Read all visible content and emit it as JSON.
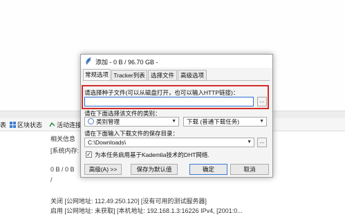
{
  "background": {
    "toolbar": {
      "left_partial": "表",
      "block_status": "区块状态",
      "active_connections": "活动连接"
    },
    "panel": {
      "related_info": "相关信息",
      "system_info": "[系统内存: ...",
      "transfer": "0 B / 0 B",
      "slash": "/",
      "log_line1": "关闭 [公网地址: 112.49.250.120] [没有可用的测试服务器]",
      "log_line2": "启用 [公网地址: 未获取] [本机地址: 192.168.1.3:16226 IPv4, [2001:0..."
    }
  },
  "dialog": {
    "title": "添加 - 0 B / 96.70 GB -",
    "tabs": [
      "常规选项",
      "Tracker列表",
      "选择文件",
      "高级选项"
    ],
    "active_tab": 0,
    "seed_label": "请选择种子文件(可以从磁盘打开，也可以输入HTTP链接)：",
    "seed_value": "",
    "browse_label": "...",
    "category_label": "请在下面选择该文件的类别：",
    "category_value": "类别管理",
    "download_mode": "下载 (普通下载任务)",
    "save_dir_label": "请在下面输入下载文件的保存目录：",
    "save_dir_value": "C:\\Downloads\\",
    "dht_label": "为本任务启用基于Kademlia技术的DHT网络.",
    "dht_checked": true,
    "buttons": {
      "advanced": "高级(A) >>",
      "save_default": "保存为默认值",
      "ok": "确定",
      "cancel": "取消"
    },
    "colors": {
      "highlight": "#d62b2b",
      "focus": "#2c6fd0"
    }
  }
}
